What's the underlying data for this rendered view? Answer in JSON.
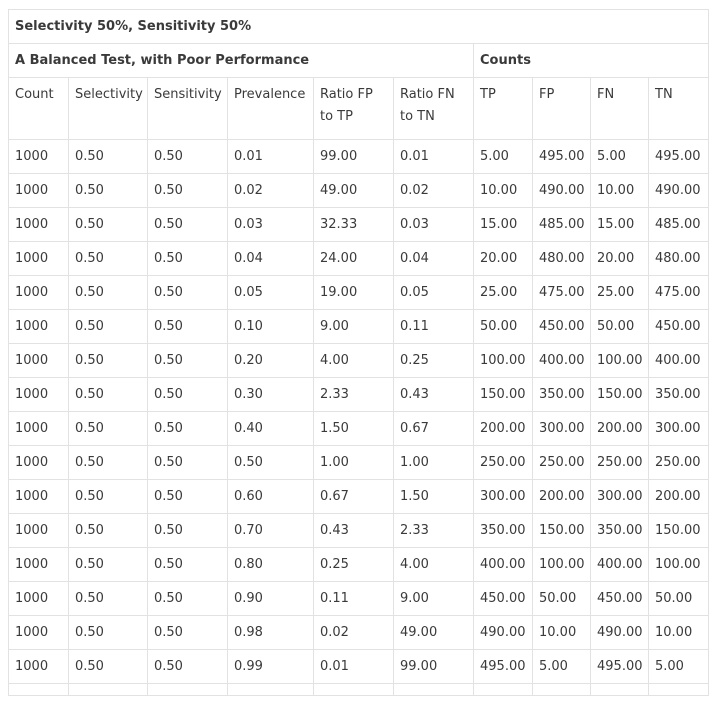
{
  "table": {
    "title": "Selectivity 50%, Sensitivity 50%",
    "group_left": "A Balanced Test, with Poor Performance",
    "group_right": "Counts",
    "headers": [
      "Count",
      "Selectivity",
      "Sensitivity",
      "Prevalence",
      "Ratio FP to TP",
      "Ratio FN to TN",
      "TP",
      "FP",
      "FN",
      "TN"
    ],
    "rows": [
      [
        "1000",
        "0.50",
        "0.50",
        "0.01",
        "99.00",
        "0.01",
        "5.00",
        "495.00",
        "5.00",
        "495.00"
      ],
      [
        "1000",
        "0.50",
        "0.50",
        "0.02",
        "49.00",
        "0.02",
        "10.00",
        "490.00",
        "10.00",
        "490.00"
      ],
      [
        "1000",
        "0.50",
        "0.50",
        "0.03",
        "32.33",
        "0.03",
        "15.00",
        "485.00",
        "15.00",
        "485.00"
      ],
      [
        "1000",
        "0.50",
        "0.50",
        "0.04",
        "24.00",
        "0.04",
        "20.00",
        "480.00",
        "20.00",
        "480.00"
      ],
      [
        "1000",
        "0.50",
        "0.50",
        "0.05",
        "19.00",
        "0.05",
        "25.00",
        "475.00",
        "25.00",
        "475.00"
      ],
      [
        "1000",
        "0.50",
        "0.50",
        "0.10",
        "9.00",
        "0.11",
        "50.00",
        "450.00",
        "50.00",
        "450.00"
      ],
      [
        "1000",
        "0.50",
        "0.50",
        "0.20",
        "4.00",
        "0.25",
        "100.00",
        "400.00",
        "100.00",
        "400.00"
      ],
      [
        "1000",
        "0.50",
        "0.50",
        "0.30",
        "2.33",
        "0.43",
        "150.00",
        "350.00",
        "150.00",
        "350.00"
      ],
      [
        "1000",
        "0.50",
        "0.50",
        "0.40",
        "1.50",
        "0.67",
        "200.00",
        "300.00",
        "200.00",
        "300.00"
      ],
      [
        "1000",
        "0.50",
        "0.50",
        "0.50",
        "1.00",
        "1.00",
        "250.00",
        "250.00",
        "250.00",
        "250.00"
      ],
      [
        "1000",
        "0.50",
        "0.50",
        "0.60",
        "0.67",
        "1.50",
        "300.00",
        "200.00",
        "300.00",
        "200.00"
      ],
      [
        "1000",
        "0.50",
        "0.50",
        "0.70",
        "0.43",
        "2.33",
        "350.00",
        "150.00",
        "350.00",
        "150.00"
      ],
      [
        "1000",
        "0.50",
        "0.50",
        "0.80",
        "0.25",
        "4.00",
        "400.00",
        "100.00",
        "400.00",
        "100.00"
      ],
      [
        "1000",
        "0.50",
        "0.50",
        "0.90",
        "0.11",
        "9.00",
        "450.00",
        "50.00",
        "450.00",
        "50.00"
      ],
      [
        "1000",
        "0.50",
        "0.50",
        "0.98",
        "0.02",
        "49.00",
        "490.00",
        "10.00",
        "490.00",
        "10.00"
      ],
      [
        "1000",
        "0.50",
        "0.50",
        "0.99",
        "0.01",
        "99.00",
        "495.00",
        "5.00",
        "495.00",
        "5.00"
      ]
    ]
  }
}
